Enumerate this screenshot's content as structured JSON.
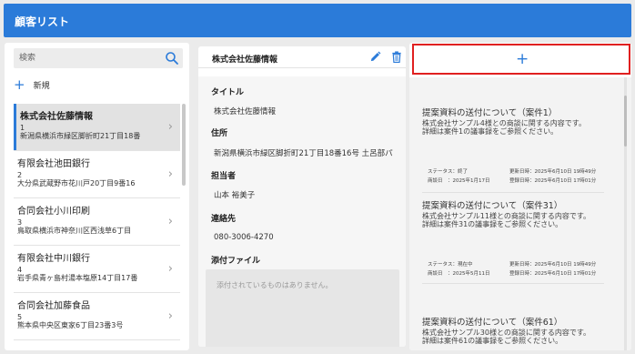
{
  "header": {
    "title": "顧客リスト"
  },
  "sidebar": {
    "search_placeholder": "検索",
    "new_label": "新規",
    "customers": [
      {
        "name": "株式会社佐藤情報",
        "num": "1",
        "address": "新潟県横浜市緑区脚折町21丁目18番"
      },
      {
        "name": "有限会社池田銀行",
        "num": "2",
        "address": "大分県武蔵野市花川戸20丁目9番16"
      },
      {
        "name": "合同会社小川印刷",
        "num": "3",
        "address": "鳥取県横浜市神奈川区西浅草6丁目"
      },
      {
        "name": "有限会社中川銀行",
        "num": "4",
        "address": "岩手県青ヶ島村湯本塩原14丁目17番"
      },
      {
        "name": "合同会社加藤食品",
        "num": "5",
        "address": "熊本県中央区東家6丁目23番3号"
      }
    ]
  },
  "detail": {
    "company": "株式会社佐藤情報",
    "title_label": "タイトル",
    "title_value": "株式会社佐藤情報",
    "address_label": "住所",
    "address_value": "新潟県横浜市緑区脚折町21丁目18番16号 土呂部パ",
    "contact_person_label": "担当者",
    "contact_person_value": "山本 裕美子",
    "phone_label": "連絡先",
    "phone_value": "080-3006-4270",
    "attachment_label": "添付ファイル",
    "attachment_empty": "添付されているものはありません。"
  },
  "proposals": {
    "items": [
      {
        "title": "提案資料の送付について（案件1）",
        "desc1": "株式会社サンプル4様との商談に関する内容です。",
        "desc2": "詳細は案件1の議事録をご参照ください。",
        "status": "ステータス：終了",
        "updated": "更新日時：2025年6月10日 19時49分",
        "assignee": "商談日　：2025年1月17日",
        "created": "登録日時：2025年6月10日 17時01分"
      },
      {
        "title": "提案資料の送付について（案件31）",
        "desc1": "株式会社サンプル11様との商談に関する内容です。",
        "desc2": "詳細は案件31の議事録をご参照ください。",
        "status": "ステータス：現在中",
        "updated": "更新日時：2025年6月10日 19時49分",
        "assignee": "商談日　：2025年5月11日",
        "created": "登録日時：2025年6月10日 17時01分"
      },
      {
        "title": "提案資料の送付について（案件61）",
        "desc1": "株式会社サンプル30様との商談に関する内容です。",
        "desc2": "詳細は案件61の議事録をご参照ください。"
      }
    ]
  }
}
